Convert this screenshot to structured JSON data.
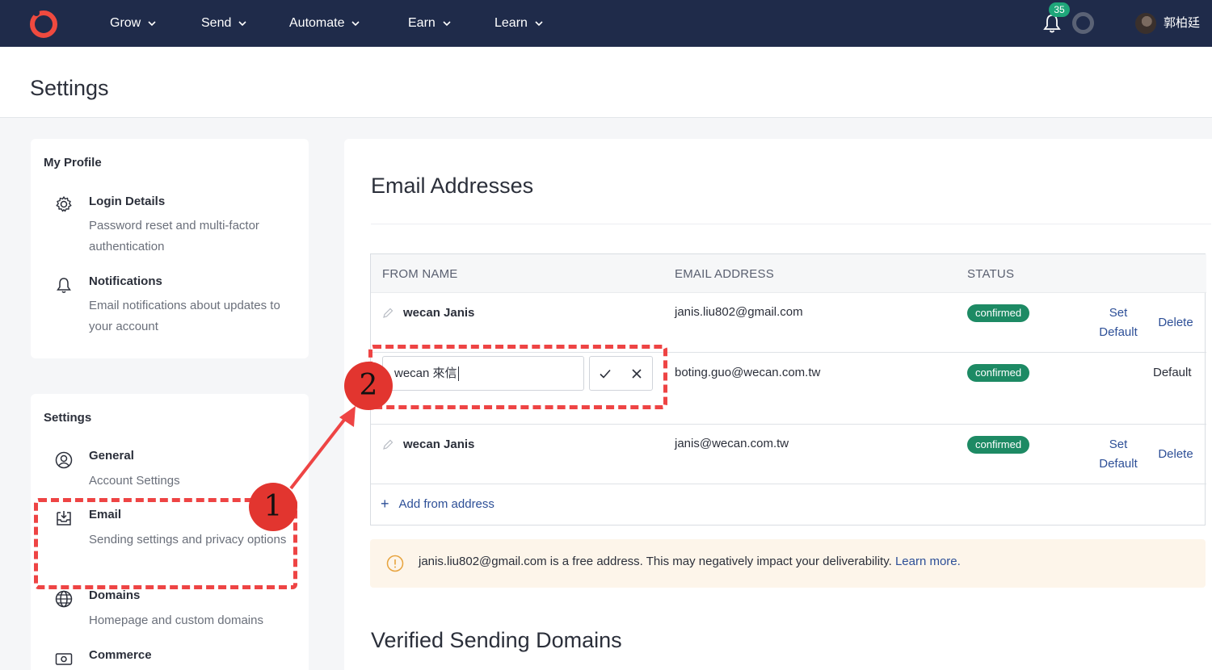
{
  "nav": {
    "items": [
      {
        "label": "Grow"
      },
      {
        "label": "Send"
      },
      {
        "label": "Automate"
      },
      {
        "label": "Earn"
      },
      {
        "label": "Learn"
      }
    ],
    "notification_count": "35",
    "user_name": "郭柏廷",
    "brand_color": "#1f2b4a"
  },
  "page": {
    "title": "Settings"
  },
  "profile_card": {
    "heading": "My Profile",
    "items": [
      {
        "title": "Login Details",
        "desc": "Password reset and multi-factor authentication",
        "icon": "gear-icon"
      },
      {
        "title": "Notifications",
        "desc": "Email notifications about updates to your account",
        "icon": "bell-icon"
      }
    ]
  },
  "settings_card": {
    "heading": "Settings",
    "items": [
      {
        "title": "General",
        "desc": "Account Settings",
        "icon": "user-circle-icon"
      },
      {
        "title": "Email",
        "desc": "Sending settings and privacy options",
        "icon": "inbox-download-icon"
      },
      {
        "title": "Domains",
        "desc": "Homepage and custom domains",
        "icon": "globe-icon"
      },
      {
        "title": "Commerce",
        "desc": "",
        "icon": "money-icon"
      }
    ]
  },
  "email_section": {
    "title": "Email Addresses",
    "columns": [
      "FROM NAME",
      "EMAIL ADDRESS",
      "STATUS"
    ],
    "rows": [
      {
        "from_name": "wecan Janis",
        "email": "janis.liu802@gmail.com",
        "status": "confirmed",
        "set_default": "Set\nDefault",
        "delete": "Delete"
      },
      {
        "from_name_editing": "wecan 來信",
        "email": "boting.guo@wecan.com.tw",
        "status": "confirmed",
        "default_label": "Default"
      },
      {
        "from_name": "wecan Janis",
        "email": "janis@wecan.com.tw",
        "status": "confirmed",
        "set_default": "Set\nDefault",
        "delete": "Delete"
      }
    ],
    "add_label": "Add from address",
    "warning_text": "janis.liu802@gmail.com is a free address. This may negatively impact your deliverability.",
    "warning_link": "Learn more."
  },
  "domains_section": {
    "title": "Verified Sending Domains"
  },
  "annotations": {
    "step1": "1",
    "step2": "2",
    "color": "#ee4444"
  },
  "colors": {
    "status_pill": "#1d8a64",
    "link": "#2d4f97",
    "warning_bg": "#fdf5ea"
  }
}
